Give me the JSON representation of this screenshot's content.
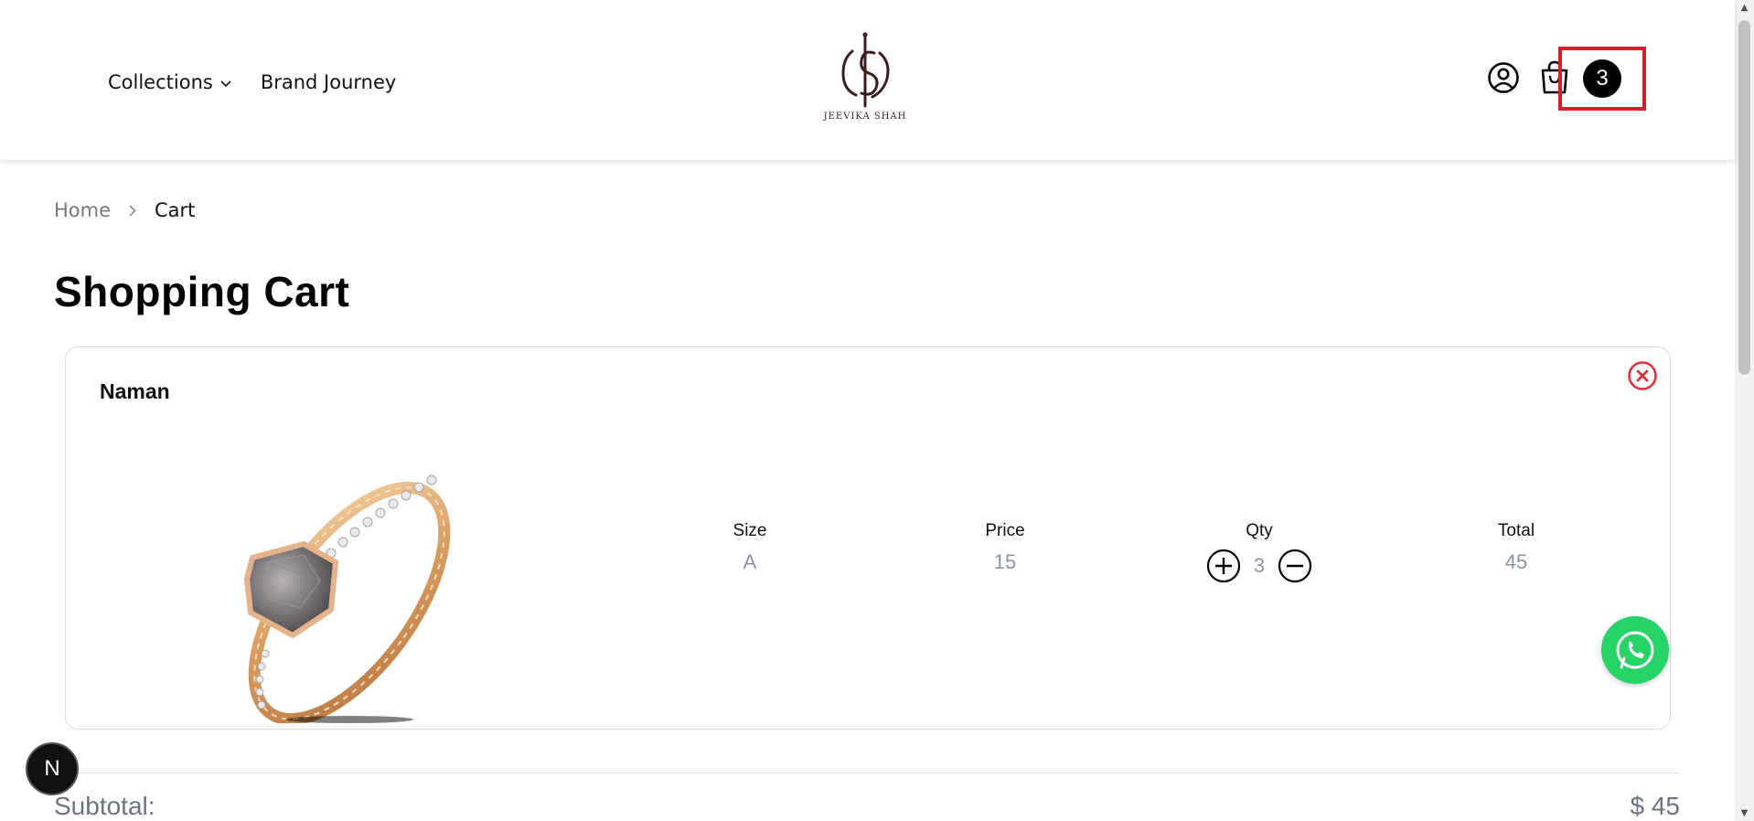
{
  "nav": {
    "collections_label": "Collections",
    "brand_journey_label": "Brand Journey"
  },
  "brand": {
    "name": "JEEVIKA SHAH",
    "color": "#3b1d1d"
  },
  "header": {
    "cart_count": "3"
  },
  "breadcrumb": {
    "home": "Home",
    "current": "Cart"
  },
  "page": {
    "title": "Shopping Cart"
  },
  "cart": {
    "items": [
      {
        "name": "Naman",
        "size_label": "Size",
        "size_value": "A",
        "price_label": "Price",
        "price_value": "15",
        "qty_label": "Qty",
        "qty_value": "3",
        "total_label": "Total",
        "total_value": "45"
      }
    ]
  },
  "summary": {
    "subtotal_label": "Subtotal:",
    "subtotal_value": "$ 45"
  },
  "floating": {
    "dev_badge": "N"
  },
  "colors": {
    "remove": "#e0303a",
    "whatsapp": "#25d366",
    "highlight": "#d91e2a",
    "muted": "#8a93a6"
  },
  "icons": [
    "chevron-down-icon",
    "user-icon",
    "shopping-bag-icon",
    "close-icon",
    "plus-icon",
    "minus-icon",
    "whatsapp-icon",
    "chevron-right-icon"
  ]
}
